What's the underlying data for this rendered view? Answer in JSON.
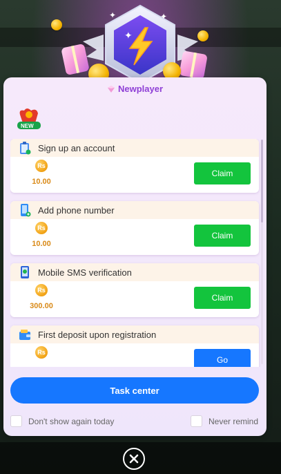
{
  "dialog": {
    "title": "Newplayer",
    "badge_text": "NEW",
    "accent_color": "#8f3fd6",
    "tasks": [
      {
        "name": "Sign up an account",
        "icon": "clipboard-icon",
        "currency": "Rs",
        "amount": "10.00",
        "action": "Claim"
      },
      {
        "name": "Add phone number",
        "icon": "phone-add-icon",
        "currency": "Rs",
        "amount": "10.00",
        "action": "Claim"
      },
      {
        "name": "Mobile SMS verification",
        "icon": "mobile-icon",
        "currency": "Rs",
        "amount": "300.00",
        "action": "Claim"
      },
      {
        "name": "First deposit upon registration",
        "icon": "wallet-icon",
        "currency": "Rs",
        "amount": "",
        "action": "Go"
      }
    ],
    "task_center_label": "Task center",
    "options": {
      "dont_show_today": "Don't show again today",
      "never_remind": "Never remind"
    }
  },
  "colors": {
    "claim": "#13c43d",
    "go": "#1677ff",
    "amount": "#d98a18"
  }
}
